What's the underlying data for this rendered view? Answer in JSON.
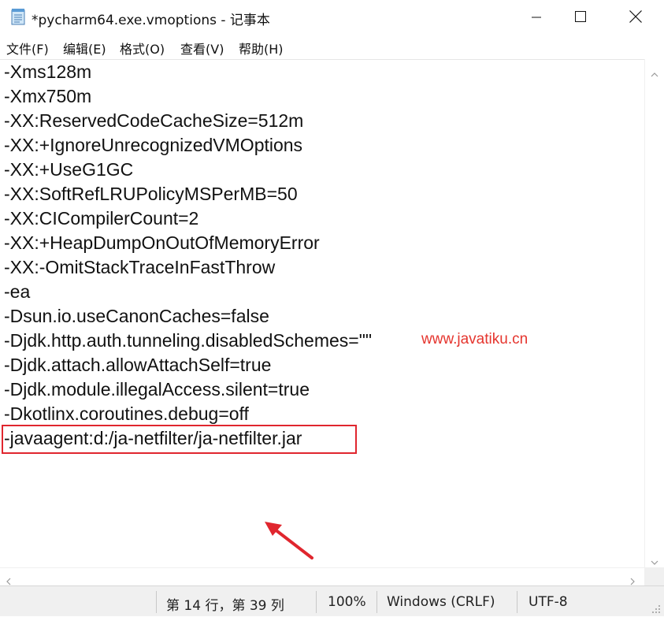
{
  "window": {
    "title": "*pycharm64.exe.vmoptions - 记事本",
    "icon": "notepad-icon",
    "controls": [
      "minimize-icon",
      "maximize-icon",
      "close-icon"
    ]
  },
  "menu": [
    "文件(F)",
    "编辑(E)",
    "格式(O)",
    "查看(V)",
    "帮助(H)"
  ],
  "editor": {
    "lines": [
      "-Xms128m",
      "-Xmx750m",
      "-XX:ReservedCodeCacheSize=512m",
      "-XX:+IgnoreUnrecognizedVMOptions",
      "-XX:+UseG1GC",
      "-XX:SoftRefLRUPolicyMSPerMB=50",
      "-XX:CICompilerCount=2",
      "-XX:+HeapDumpOnOutOfMemoryError",
      "-XX:-OmitStackTraceInFastThrow",
      "-ea",
      "-Dsun.io.useCanonCaches=false",
      "-Djdk.http.auth.tunneling.disabledSchemes=\"\"",
      "-Djdk.attach.allowAttachSelf=true",
      "-Djdk.module.illegalAccess.silent=true",
      "-Dkotlinx.coroutines.debug=off",
      "-javaagent:d:/ja-netfilter/ja-netfilter.jar"
    ],
    "watermark": "www.javatiku.cn",
    "highlight_color": "#e0262e"
  },
  "status": {
    "position": "第 14 行，第 39 列",
    "zoom": "100%",
    "line_ending": "Windows (CRLF)",
    "encoding": "UTF-8"
  }
}
